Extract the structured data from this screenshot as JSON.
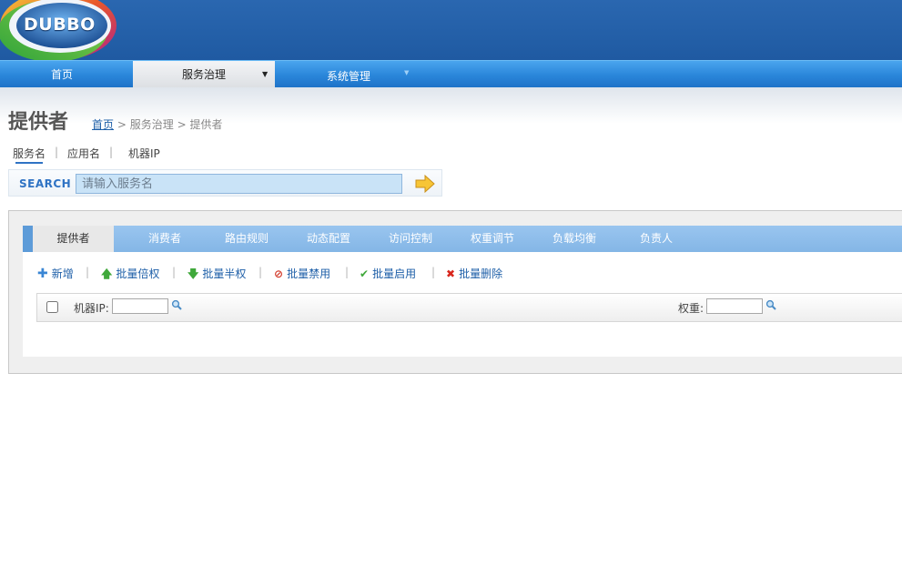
{
  "header": {
    "logo_text": "DUBBO"
  },
  "nav": {
    "items": [
      {
        "label": "首页"
      },
      {
        "label": "服务治理",
        "caret": "▼"
      },
      {
        "label": "系统管理",
        "caret": "▼"
      }
    ]
  },
  "page": {
    "title": "提供者",
    "breadcrumb": {
      "home": "首页",
      "sep": ">",
      "level1": "服务治理",
      "level2": "提供者"
    }
  },
  "search": {
    "types": [
      "服务名",
      "应用名",
      "机器IP"
    ],
    "sep": "|",
    "label": "SEARCH",
    "placeholder": "请输入服务名"
  },
  "tabs": [
    "提供者",
    "消费者",
    "路由规则",
    "动态配置",
    "访问控制",
    "权重调节",
    "负载均衡",
    "负责人"
  ],
  "toolbar": {
    "sep": "|",
    "buttons": [
      {
        "label": "新增",
        "icon": "plus-icon"
      },
      {
        "label": "批量倍权",
        "icon": "arrow-up-icon"
      },
      {
        "label": "批量半权",
        "icon": "arrow-down-icon"
      },
      {
        "label": "批量禁用",
        "icon": "forbid-icon"
      },
      {
        "label": "批量启用",
        "icon": "check-icon"
      },
      {
        "label": "批量删除",
        "icon": "delete-icon"
      }
    ]
  },
  "filter": {
    "ip_label": "机器IP:",
    "weight_label": "权重:"
  },
  "colors": {
    "header": "#2463ac",
    "nav": "#2a86da",
    "tabbar": "#8bbbe9",
    "link": "#1e5fa8"
  }
}
